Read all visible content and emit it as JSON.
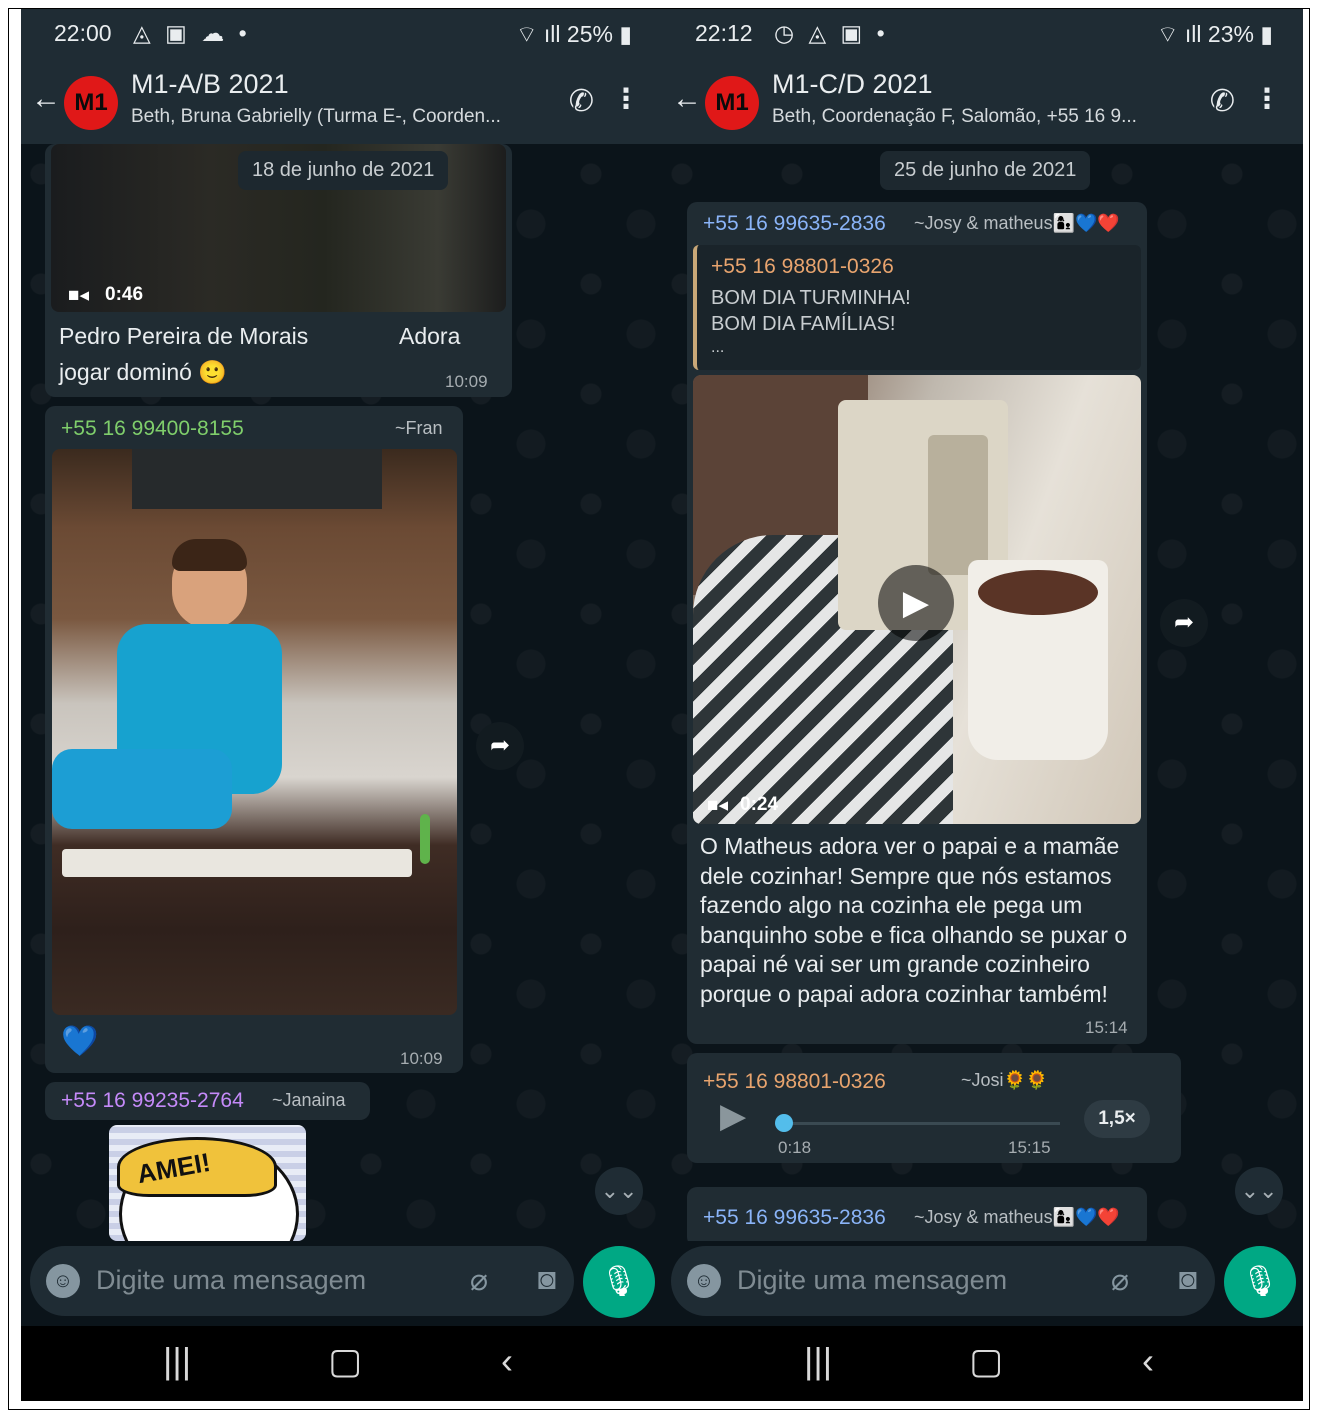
{
  "left": {
    "status": {
      "time": "22:00",
      "icons": "◬ ▣ ☁ •",
      "battery": "25%"
    },
    "header": {
      "avatar": "M1",
      "title": "M1-A/B 2021",
      "subtitle": "Beth, Bruna Gabrielly (Turma E-, Coorden..."
    },
    "date_chip": "18 de junho de 2021",
    "msg1": {
      "video_duration": "0:46",
      "text_line1": "Pedro Pereira de Morais",
      "text_line1_right": "Adora",
      "text_line2": "jogar dominó 🙂",
      "time": "10:09"
    },
    "msg2": {
      "sender": "+55 16 99400-8155",
      "alias": "~Fran",
      "reaction": "💙",
      "time": "10:09"
    },
    "msg3": {
      "sender": "+55 16 99235-2764",
      "alias": "~Janaina",
      "sticker_text": "AMEI!"
    },
    "input_placeholder": "Digite uma mensagem"
  },
  "right": {
    "status": {
      "time": "22:12",
      "icons": "◷ ◬ ▣ •",
      "battery": "23%"
    },
    "header": {
      "avatar": "M1",
      "title": "M1-C/D 2021",
      "subtitle": "Beth, Coordenação F, Salomão, +55 16 9..."
    },
    "date_chip": "25 de junho de 2021",
    "msg1": {
      "sender": "+55 16 99635-2836",
      "alias": "~Josy & matheus👩‍👦💙❤️",
      "quote_sender": "+55 16 98801-0326",
      "quote_line1": "BOM DIA TURMINHA!",
      "quote_line2": "BOM DIA FAMÍLIAS!",
      "quote_line3": "...",
      "video_duration": "0:24",
      "text": "O Matheus adora ver o papai e a mamãe dele cozinhar! Sempre que nós estamos fazendo algo na cozinha ele pega um banquinho sobe e fica olhando se puxar o papai né vai ser um grande cozinheiro porque o papai adora cozinhar também!",
      "time": "15:14"
    },
    "msg2": {
      "sender": "+55 16 98801-0326",
      "alias": "~Josi🌻🌻",
      "duration": "0:18",
      "time": "15:15",
      "speed": "1,5×",
      "progress": 0.02
    },
    "msg3": {
      "sender": "+55 16 99635-2836",
      "alias": "~Josy & matheus👩‍👦💙❤️"
    },
    "input_placeholder": "Digite uma mensagem"
  },
  "colors": {
    "accent": "#00a884",
    "sender_green": "#7fce6b",
    "sender_blue": "#8ab4f8",
    "sender_purple": "#c58af9",
    "sender_orange": "#e8a46e"
  }
}
